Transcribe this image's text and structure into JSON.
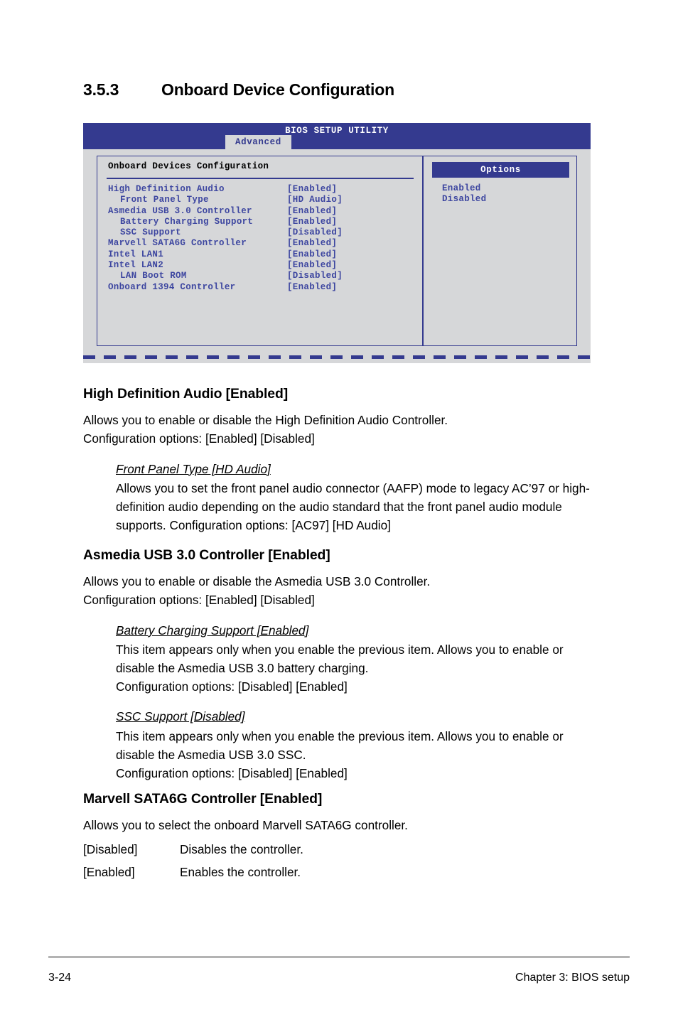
{
  "heading": {
    "number": "3.5.3",
    "title": "Onboard Device Configuration"
  },
  "bios": {
    "utility_title": "BIOS SETUP UTILITY",
    "active_tab": "Advanced",
    "section_title": "Onboard Devices Configuration",
    "items": [
      {
        "label": "High Definition Audio",
        "value": "[Enabled]",
        "indent": false
      },
      {
        "label": "Front Panel Type",
        "value": "[HD Audio]",
        "indent": true
      },
      {
        "label": "Asmedia USB 3.0 Controller",
        "value": "[Enabled]",
        "indent": false
      },
      {
        "label": "Battery Charging Support",
        "value": "[Enabled]",
        "indent": true
      },
      {
        "label": "SSC Support",
        "value": "[Disabled]",
        "indent": true
      },
      {
        "label": "Marvell SATA6G Controller",
        "value": "[Enabled]",
        "indent": false
      },
      {
        "label": "Intel LAN1",
        "value": "[Enabled]",
        "indent": false
      },
      {
        "label": "Intel LAN2",
        "value": "[Enabled]",
        "indent": false
      },
      {
        "label": "LAN Boot ROM",
        "value": "[Disabled]",
        "indent": true
      },
      {
        "label": "Onboard 1394 Controller",
        "value": "[Enabled]",
        "indent": false
      }
    ],
    "options_header": "Options",
    "options": [
      "Enabled",
      "Disabled"
    ],
    "colors": {
      "header_blue": "#343a8f",
      "panel_gray": "#d6d7d9",
      "item_blue": "#3d46a0"
    }
  },
  "sections": {
    "hda": {
      "heading": "High Definition Audio [Enabled]",
      "line1": "Allows you to enable or disable the High Definition Audio Controller.",
      "line2": "Configuration options: [Enabled] [Disabled]",
      "sub": {
        "heading": "Front Panel Type [HD Audio]",
        "body": "Allows you to set the front panel audio connector (AAFP) mode to legacy AC’97 or high-definition audio depending on the audio standard that the front panel audio module supports. Configuration options: [AC97] [HD Audio]"
      }
    },
    "asmedia": {
      "heading": "Asmedia USB 3.0 Controller [Enabled]",
      "line1": "Allows you to enable or disable the Asmedia USB 3.0 Controller.",
      "line2": "Configuration options: [Enabled] [Disabled]",
      "sub1": {
        "heading": "Battery Charging Support [Enabled]",
        "body": "This item appears only when you enable the previous item. Allows you to enable or disable the Asmedia USB 3.0 battery charging.",
        "options": "Configuration options: [Disabled] [Enabled]"
      },
      "sub2": {
        "heading": "SSC Support [Disabled]",
        "body": "This item appears only when you enable the previous item. Allows you to enable or disable the Asmedia USB 3.0 SSC.",
        "options": "Configuration options: [Disabled] [Enabled]"
      }
    },
    "marvell": {
      "heading": "Marvell SATA6G Controller [Enabled]",
      "line1": "Allows you to select the onboard Marvell SATA6G controller.",
      "opt_disabled_key": "[Disabled]",
      "opt_disabled_desc": "Disables the controller.",
      "opt_enabled_key": "[Enabled]",
      "opt_enabled_desc": "Enables the controller."
    }
  },
  "footer": {
    "page_number": "3-24",
    "chapter": "Chapter 3: BIOS setup"
  }
}
